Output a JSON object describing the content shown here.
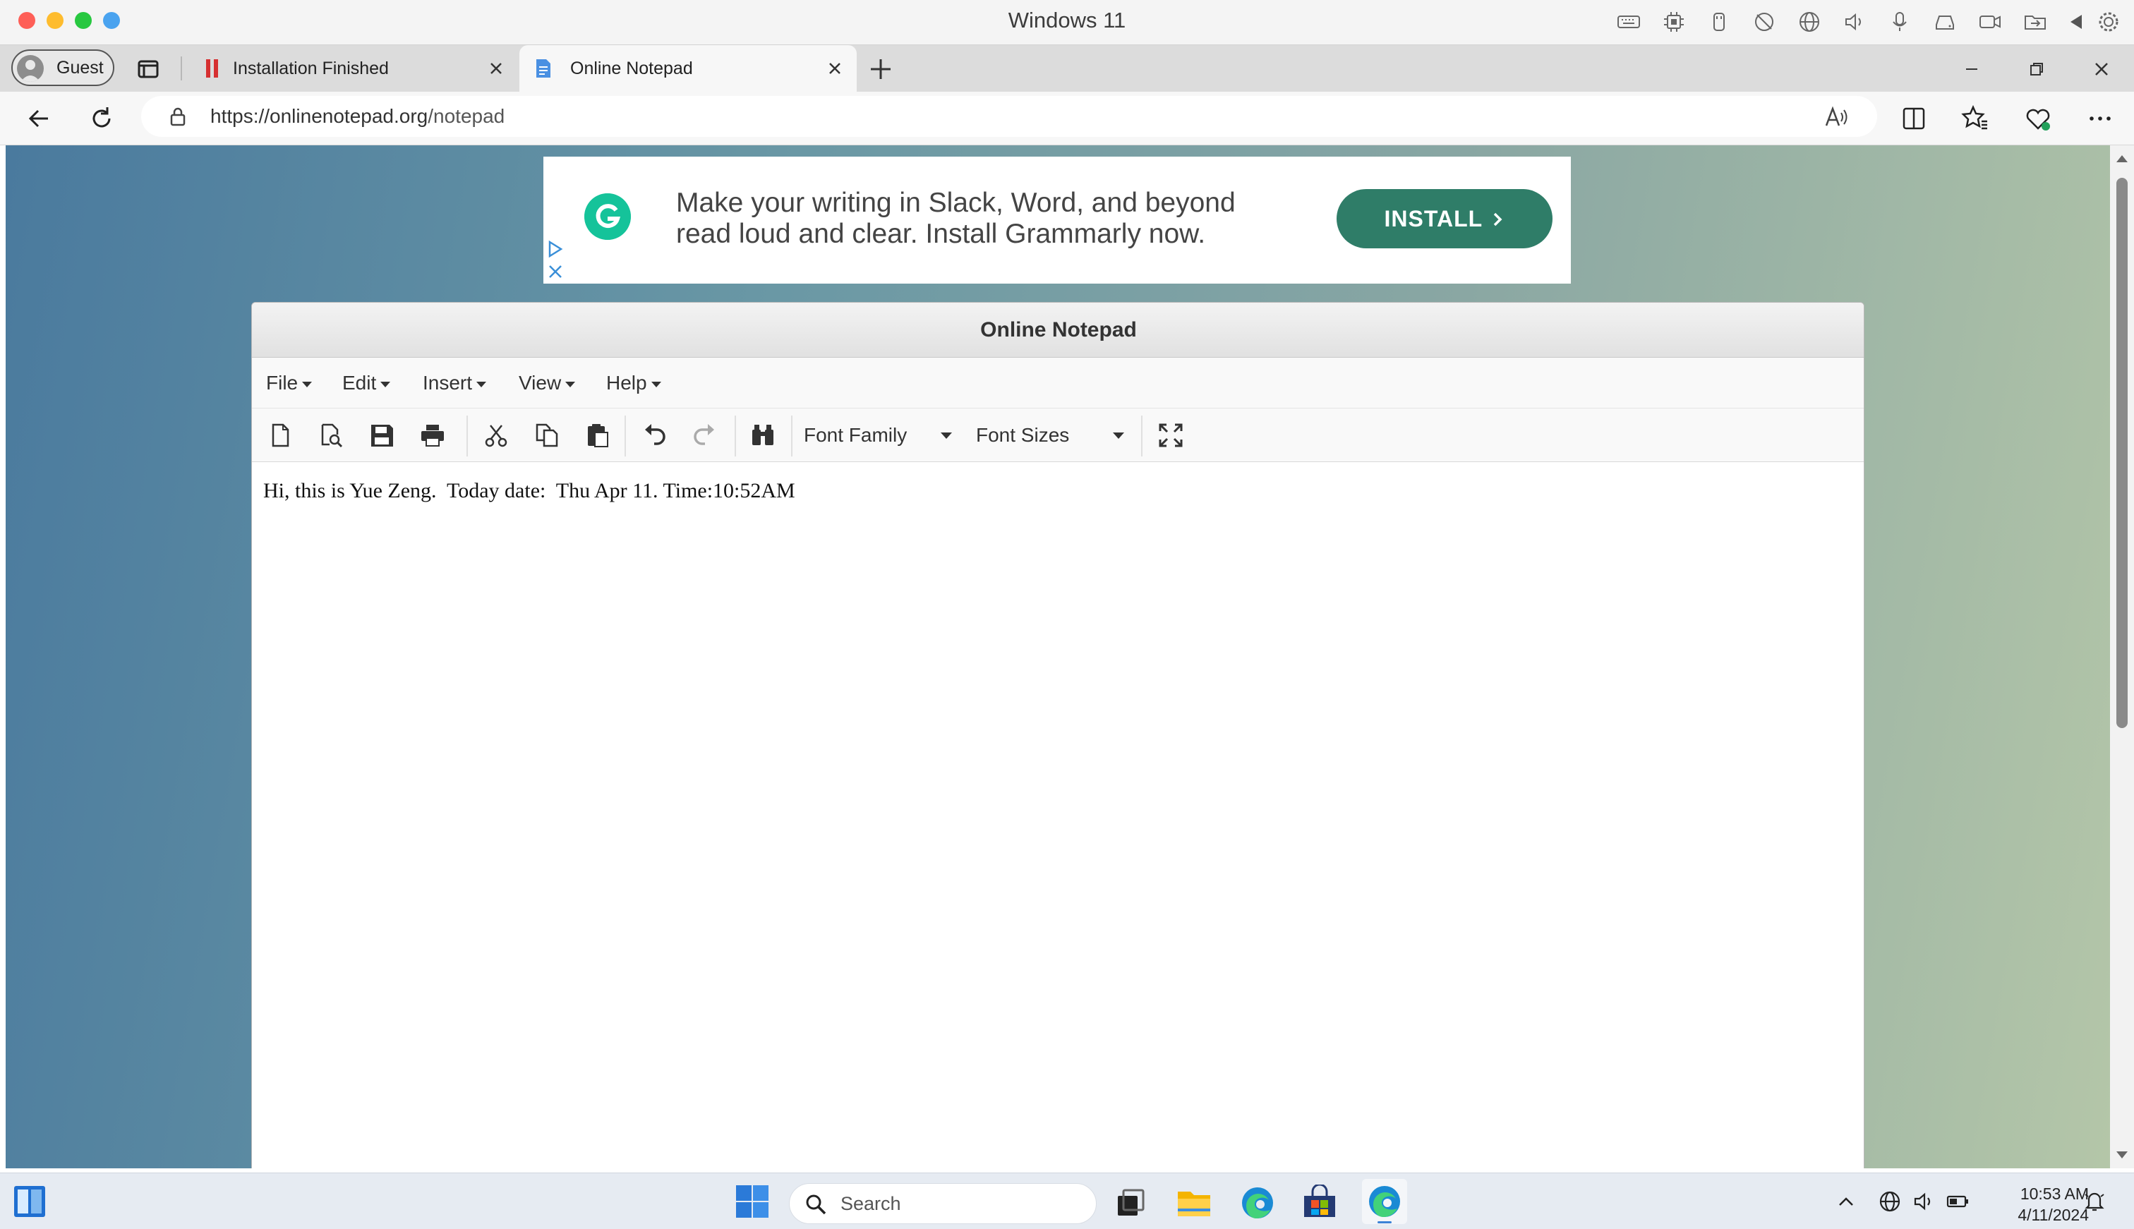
{
  "window": {
    "title": "Windows 11"
  },
  "browser": {
    "profile_label": "Guest",
    "tabs": [
      {
        "label": "Installation Finished",
        "active": false,
        "icon": "red-stripes-icon"
      },
      {
        "label": "Online Notepad",
        "active": true,
        "icon": "document-icon"
      }
    ],
    "address": {
      "scheme_host": "https://onlinenotepad.org",
      "path": "/notepad"
    }
  },
  "ad": {
    "line1": "Make your writing in Slack, Word, and beyond",
    "line2": "read loud and clear. Install Grammarly now.",
    "button_label": "INSTALL",
    "brand_color": "#15c39a",
    "button_color": "#2f7d68"
  },
  "notepad": {
    "title": "Online Notepad",
    "menu": [
      "File",
      "Edit",
      "Insert",
      "View",
      "Help"
    ],
    "font_family_label": "Font Family",
    "font_sizes_label": "Font Sizes",
    "content": "Hi, this is Yue Zeng.  Today date:  Thu Apr 11. Time:10:52AM"
  },
  "taskbar": {
    "search_label": "Search",
    "time": "10:53 AM",
    "date": "4/11/2024"
  }
}
